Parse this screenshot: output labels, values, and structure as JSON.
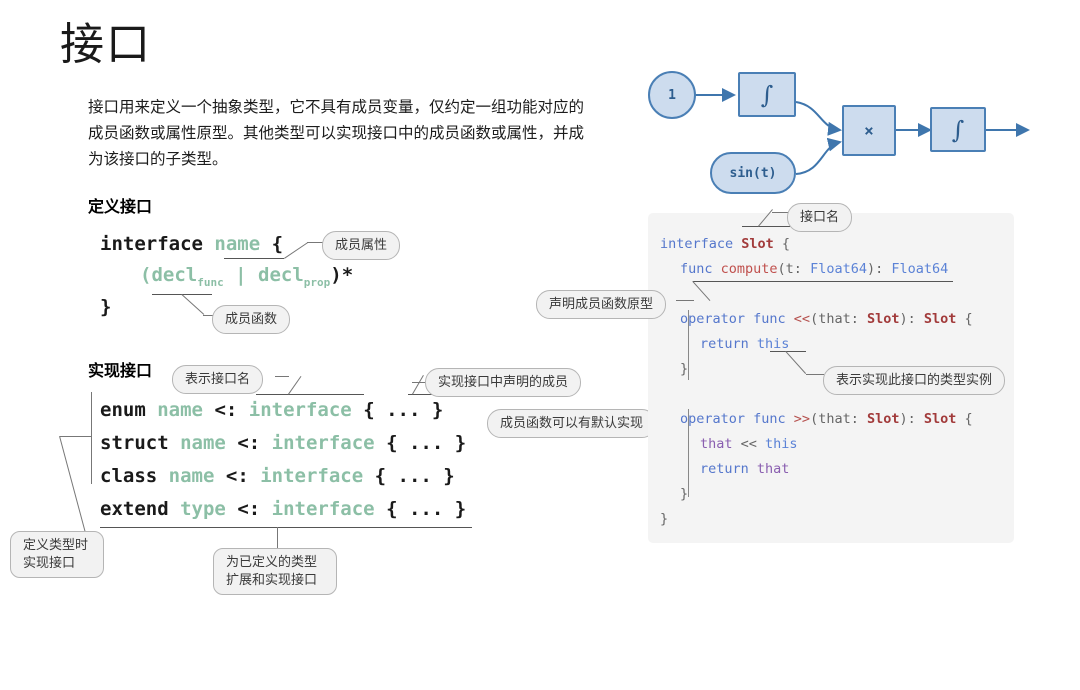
{
  "doc": {
    "title": "接口",
    "intro": "接口用来定义一个抽象类型，它不具有成员变量，仅约定一组功能对应的成员函数或属性原型。其他类型可以实现接口中的成员函数或属性，并成为该接口的子类型。",
    "section_define": "定义接口",
    "section_implement": "实现接口"
  },
  "syntax_define": {
    "line1_kw": "interface",
    "line1_name": "name",
    "line1_brace": "{",
    "line2": "(decl",
    "line2_sub1": "func",
    "line2_mid": " | decl",
    "line2_sub2": "prop",
    "line2_end": ")*",
    "line3": "}"
  },
  "syntax_implement": {
    "rows": [
      {
        "kw": "enum",
        "name": "name",
        "op": "<:",
        "iface": "interface",
        "body": "{ ... }"
      },
      {
        "kw": "struct",
        "name": "name",
        "op": "<:",
        "iface": "interface",
        "body": "{ ... }"
      },
      {
        "kw": "class",
        "name": "name",
        "op": "<:",
        "iface": "interface",
        "body": "{ ... }"
      },
      {
        "kw": "extend",
        "name": "type",
        "op": "<:",
        "iface": "interface",
        "body": "{ ... }"
      }
    ]
  },
  "callouts": {
    "member_property": "成员属性",
    "member_function": "成员函数",
    "show_interface_name": "表示接口名",
    "implement_declared_members": "实现接口中声明的成员",
    "member_func_default_impl": "成员函数可以有默认实现",
    "define_type_impl_interface": "定义类型时\n实现接口",
    "extend_existing_type": "为已定义的类型\n扩展和实现接口",
    "interface_name": "接口名",
    "declare_member_func_proto": "声明成员函数原型",
    "this_type_instance": "表示实现此接口的类型实例"
  },
  "flow_diagram": {
    "nodes": [
      {
        "id": "one",
        "label": "1",
        "shape": "circle"
      },
      {
        "id": "int1",
        "label": "∫",
        "shape": "rect"
      },
      {
        "id": "sin",
        "label": "sin(t)",
        "shape": "pill"
      },
      {
        "id": "mul",
        "label": "×",
        "shape": "rect"
      },
      {
        "id": "int2",
        "label": "∫",
        "shape": "rect"
      }
    ],
    "fill": "#cddcee",
    "stroke": "#4a7fb5",
    "text_color": "#2d5d8e"
  },
  "code": {
    "lines": [
      {
        "indent": 0,
        "tokens": [
          {
            "t": "interface ",
            "c": "kw"
          },
          {
            "t": "Slot",
            "c": "ty"
          },
          {
            "t": " {",
            "c": "pl"
          }
        ]
      },
      {
        "indent": 1,
        "tokens": [
          {
            "t": "func ",
            "c": "kw"
          },
          {
            "t": "compute",
            "c": "fn"
          },
          {
            "t": "(t: ",
            "c": "pl"
          },
          {
            "t": "Float64",
            "c": "nm"
          },
          {
            "t": "): ",
            "c": "pl"
          },
          {
            "t": "Float64",
            "c": "nm"
          }
        ]
      },
      {
        "indent": 0,
        "tokens": [
          {
            "t": "",
            "c": "pl"
          }
        ]
      },
      {
        "indent": 1,
        "tokens": [
          {
            "t": "operator func ",
            "c": "kw"
          },
          {
            "t": "<<",
            "c": "op"
          },
          {
            "t": "(that: ",
            "c": "pl"
          },
          {
            "t": "Slot",
            "c": "ty"
          },
          {
            "t": "): ",
            "c": "pl"
          },
          {
            "t": "Slot",
            "c": "ty"
          },
          {
            "t": " {",
            "c": "pl"
          }
        ]
      },
      {
        "indent": 2,
        "tokens": [
          {
            "t": "return ",
            "c": "kw"
          },
          {
            "t": "this",
            "c": "nm"
          }
        ]
      },
      {
        "indent": 1,
        "tokens": [
          {
            "t": "}",
            "c": "pl"
          }
        ]
      },
      {
        "indent": 0,
        "tokens": [
          {
            "t": "",
            "c": "pl"
          }
        ]
      },
      {
        "indent": 1,
        "tokens": [
          {
            "t": "operator func ",
            "c": "kw"
          },
          {
            "t": ">>",
            "c": "op"
          },
          {
            "t": "(that: ",
            "c": "pl"
          },
          {
            "t": "Slot",
            "c": "ty"
          },
          {
            "t": "): ",
            "c": "pl"
          },
          {
            "t": "Slot",
            "c": "ty"
          },
          {
            "t": " {",
            "c": "pl"
          }
        ]
      },
      {
        "indent": 2,
        "tokens": [
          {
            "t": "that",
            "c": "pm"
          },
          {
            "t": " << ",
            "c": "pl"
          },
          {
            "t": "this",
            "c": "nm"
          }
        ]
      },
      {
        "indent": 2,
        "tokens": [
          {
            "t": "return ",
            "c": "kw"
          },
          {
            "t": "that",
            "c": "pm"
          }
        ]
      },
      {
        "indent": 1,
        "tokens": [
          {
            "t": "}",
            "c": "pl"
          }
        ]
      },
      {
        "indent": 0,
        "tokens": [
          {
            "t": "}",
            "c": "pl"
          }
        ]
      }
    ],
    "background": "#f4f4f4"
  },
  "colors": {
    "syntax_green": "#8cbfa6",
    "callout_border": "#b5b5b5",
    "callout_fill": "#f2f2f2",
    "code_keyword": "#5577cc",
    "code_type": "#a23b3b"
  }
}
